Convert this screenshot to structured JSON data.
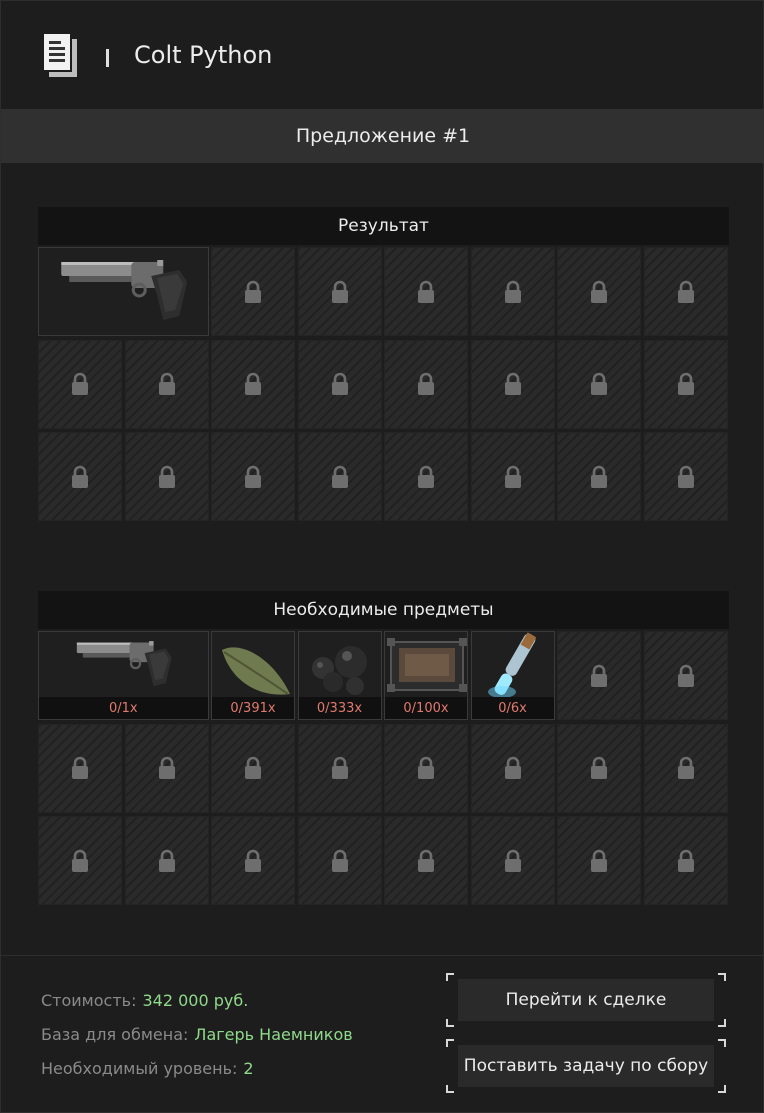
{
  "header": {
    "title": "Colt Python",
    "icon": "document-icon"
  },
  "offer": {
    "title": "Предложение #1"
  },
  "result": {
    "title": "Результат",
    "item": {
      "name": "Colt Python",
      "icon": "revolver-icon"
    }
  },
  "required": {
    "title": "Необходимые предметы",
    "items": [
      {
        "icon": "revolver-icon",
        "count": "0/1x"
      },
      {
        "icon": "leaf-icon",
        "count": "0/391x"
      },
      {
        "icon": "black-blobs-icon",
        "count": "0/333x"
      },
      {
        "icon": "device-case-icon",
        "count": "0/100x"
      },
      {
        "icon": "glowing-vial-icon",
        "count": "0/6x"
      }
    ]
  },
  "info": {
    "cost_label": "Стоимость:",
    "cost_value": "342 000 руб.",
    "base_label": "База для обмена:",
    "base_value": "Лагерь Наемников",
    "level_label": "Необходимый уровень:",
    "level_value": "2"
  },
  "buttons": {
    "go_to_deal": "Перейти к сделке",
    "set_task": "Поставить задачу по сбору"
  },
  "colors": {
    "accent_green": "#8fd98a",
    "count_red": "#e07a6e"
  }
}
